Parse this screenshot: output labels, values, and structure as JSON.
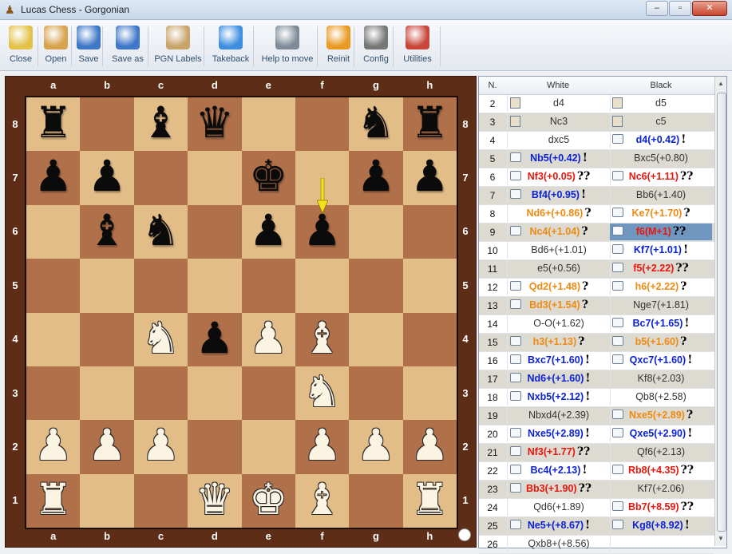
{
  "window": {
    "title": "Lucas Chess - Gorgonian"
  },
  "toolbar": [
    {
      "label": "Close",
      "icon": "person-icon"
    },
    {
      "label": "Open",
      "icon": "folder-icon"
    },
    {
      "label": "Save",
      "icon": "floppy-icon"
    },
    {
      "label": "Save as",
      "icon": "floppy-export-icon"
    },
    {
      "label": "PGN Labels",
      "icon": "clipboard-icon"
    },
    {
      "label": "Takeback",
      "icon": "up-arrow-icon"
    },
    {
      "label": "Help to move",
      "icon": "gears-icon"
    },
    {
      "label": "Reinit",
      "icon": "refresh-icon"
    },
    {
      "label": "Config",
      "icon": "gear-icon"
    },
    {
      "label": "Utilities",
      "icon": "tools-icon"
    }
  ],
  "board": {
    "files": [
      "a",
      "b",
      "c",
      "d",
      "e",
      "f",
      "g",
      "h"
    ],
    "ranks": [
      "8",
      "7",
      "6",
      "5",
      "4",
      "3",
      "2",
      "1"
    ],
    "last_move_arrow_square": "f6",
    "pieces": [
      {
        "sq": "a8",
        "p": "r"
      },
      {
        "sq": "c8",
        "p": "b"
      },
      {
        "sq": "d8",
        "p": "q"
      },
      {
        "sq": "g8",
        "p": "n"
      },
      {
        "sq": "h8",
        "p": "r"
      },
      {
        "sq": "a7",
        "p": "p"
      },
      {
        "sq": "b7",
        "p": "p"
      },
      {
        "sq": "e7",
        "p": "k"
      },
      {
        "sq": "g7",
        "p": "p"
      },
      {
        "sq": "h7",
        "p": "p"
      },
      {
        "sq": "b6",
        "p": "b"
      },
      {
        "sq": "c6",
        "p": "n"
      },
      {
        "sq": "e6",
        "p": "p"
      },
      {
        "sq": "f6",
        "p": "p"
      },
      {
        "sq": "c4",
        "p": "N"
      },
      {
        "sq": "d4",
        "p": "p"
      },
      {
        "sq": "e4",
        "p": "P"
      },
      {
        "sq": "f4",
        "p": "B"
      },
      {
        "sq": "f3",
        "p": "N"
      },
      {
        "sq": "a2",
        "p": "P"
      },
      {
        "sq": "b2",
        "p": "P"
      },
      {
        "sq": "c2",
        "p": "P"
      },
      {
        "sq": "f2",
        "p": "P"
      },
      {
        "sq": "g2",
        "p": "P"
      },
      {
        "sq": "h2",
        "p": "P"
      },
      {
        "sq": "a1",
        "p": "R"
      },
      {
        "sq": "d1",
        "p": "Q"
      },
      {
        "sq": "e1",
        "p": "K"
      },
      {
        "sq": "f1",
        "p": "B"
      },
      {
        "sq": "h1",
        "p": "R"
      }
    ]
  },
  "moves": {
    "header": {
      "n": "N.",
      "white": "White",
      "black": "Black"
    },
    "colors": {
      "blue": "#0b22d8",
      "red": "#e8160c",
      "orange": "#f08a10",
      "gray": "#333333"
    },
    "rows": [
      {
        "n": "2",
        "w": "d4",
        "wc": "gray",
        "wi": "note",
        "wg": "",
        "b": "d5",
        "bc": "gray",
        "bi": "note",
        "bg": ""
      },
      {
        "n": "3",
        "w": "Nc3",
        "wc": "gray",
        "wi": "note",
        "wg": "",
        "b": "c5",
        "bc": "gray",
        "bi": "note",
        "bg": ""
      },
      {
        "n": "4",
        "w": "dxc5",
        "wc": "gray",
        "wi": "",
        "wg": "",
        "b": "d4(+0.42)",
        "bc": "blue",
        "bi": "comment",
        "bg": "!"
      },
      {
        "n": "5",
        "w": "Nb5(+0.42)",
        "wc": "blue",
        "wi": "comment",
        "wg": "!",
        "b": "Bxc5(+0.80)",
        "bc": "gray",
        "bi": "",
        "bg": ""
      },
      {
        "n": "6",
        "w": "Nf3(+0.05)",
        "wc": "red",
        "wi": "comment",
        "wg": "??",
        "b": "Nc6(+1.11)",
        "bc": "red",
        "bi": "comment",
        "bg": "??"
      },
      {
        "n": "7",
        "w": "Bf4(+0.95)",
        "wc": "blue",
        "wi": "comment",
        "wg": "!",
        "b": "Bb6(+1.40)",
        "bc": "gray",
        "bi": "",
        "bg": ""
      },
      {
        "n": "8",
        "w": "Nd6+(+0.86)",
        "wc": "orange",
        "wi": "",
        "wg": "?",
        "b": "Ke7(+1.70)",
        "bc": "orange",
        "bi": "comment",
        "bg": "?"
      },
      {
        "n": "9",
        "w": "Nc4(+1.04)",
        "wc": "orange",
        "wi": "comment",
        "wg": "?",
        "b": "f6(M+1)",
        "bc": "red",
        "bi": "comment",
        "bg": "??",
        "selected": true
      },
      {
        "n": "10",
        "w": "Bd6+(+1.01)",
        "wc": "gray",
        "wi": "",
        "wg": "",
        "b": "Kf7(+1.01)",
        "bc": "blue",
        "bi": "comment",
        "bg": "!"
      },
      {
        "n": "11",
        "w": "e5(+0.56)",
        "wc": "gray",
        "wi": "",
        "wg": "",
        "b": "f5(+2.22)",
        "bc": "red",
        "bi": "comment",
        "bg": "??"
      },
      {
        "n": "12",
        "w": "Qd2(+1.48)",
        "wc": "orange",
        "wi": "comment",
        "wg": "?",
        "b": "h6(+2.22)",
        "bc": "orange",
        "bi": "comment",
        "bg": "?"
      },
      {
        "n": "13",
        "w": "Bd3(+1.54)",
        "wc": "orange",
        "wi": "comment",
        "wg": "?",
        "b": "Nge7(+1.81)",
        "bc": "gray",
        "bi": "",
        "bg": ""
      },
      {
        "n": "14",
        "w": "O-O(+1.62)",
        "wc": "gray",
        "wi": "",
        "wg": "",
        "b": "Bc7(+1.65)",
        "bc": "blue",
        "bi": "comment",
        "bg": "!"
      },
      {
        "n": "15",
        "w": "h3(+1.13)",
        "wc": "orange",
        "wi": "comment",
        "wg": "?",
        "b": "b5(+1.60)",
        "bc": "orange",
        "bi": "comment",
        "bg": "?"
      },
      {
        "n": "16",
        "w": "Bxc7(+1.60)",
        "wc": "blue",
        "wi": "comment",
        "wg": "!",
        "b": "Qxc7(+1.60)",
        "bc": "blue",
        "bi": "comment",
        "bg": "!"
      },
      {
        "n": "17",
        "w": "Nd6+(+1.60)",
        "wc": "blue",
        "wi": "comment",
        "wg": "!",
        "b": "Kf8(+2.03)",
        "bc": "gray",
        "bi": "",
        "bg": ""
      },
      {
        "n": "18",
        "w": "Nxb5(+2.12)",
        "wc": "blue",
        "wi": "comment",
        "wg": "!",
        "b": "Qb8(+2.58)",
        "bc": "gray",
        "bi": "",
        "bg": ""
      },
      {
        "n": "19",
        "w": "Nbxd4(+2.39)",
        "wc": "gray",
        "wi": "",
        "wg": "",
        "b": "Nxe5(+2.89)",
        "bc": "orange",
        "bi": "comment",
        "bg": "?"
      },
      {
        "n": "20",
        "w": "Nxe5(+2.89)",
        "wc": "blue",
        "wi": "comment",
        "wg": "!",
        "b": "Qxe5(+2.90)",
        "bc": "blue",
        "bi": "comment",
        "bg": "!"
      },
      {
        "n": "21",
        "w": "Nf3(+1.77)",
        "wc": "red",
        "wi": "comment",
        "wg": "??",
        "b": "Qf6(+2.13)",
        "bc": "gray",
        "bi": "",
        "bg": ""
      },
      {
        "n": "22",
        "w": "Bc4(+2.13)",
        "wc": "blue",
        "wi": "comment",
        "wg": "!",
        "b": "Rb8(+4.35)",
        "bc": "red",
        "bi": "comment",
        "bg": "??"
      },
      {
        "n": "23",
        "w": "Bb3(+1.90)",
        "wc": "red",
        "wi": "comment",
        "wg": "??",
        "b": "Kf7(+2.06)",
        "bc": "gray",
        "bi": "",
        "bg": ""
      },
      {
        "n": "24",
        "w": "Qd6(+1.89)",
        "wc": "gray",
        "wi": "",
        "wg": "",
        "b": "Bb7(+8.59)",
        "bc": "red",
        "bi": "comment",
        "bg": "??"
      },
      {
        "n": "25",
        "w": "Ne5+(+8.67)",
        "wc": "blue",
        "wi": "comment",
        "wg": "!",
        "b": "Kg8(+8.92)",
        "bc": "blue",
        "bi": "comment",
        "bg": "!"
      },
      {
        "n": "26",
        "w": "Qxb8+(+8.56)",
        "wc": "gray",
        "wi": "",
        "wg": "",
        "b": "",
        "bc": "gray",
        "bi": "",
        "bg": ""
      }
    ]
  }
}
